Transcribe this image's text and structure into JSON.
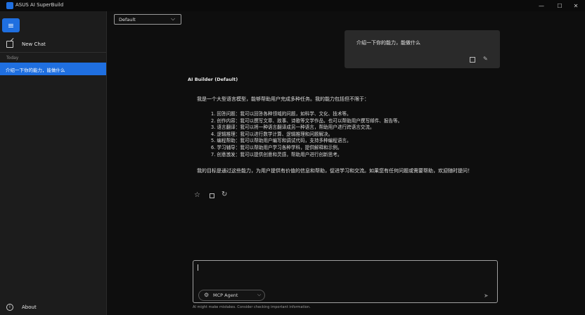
{
  "app": {
    "title": "ASUS AI SuperBuild",
    "window_controls": {
      "minimize": "—",
      "maximize": "☐",
      "close": "✕"
    }
  },
  "sidebar": {
    "menu_icon": "≡",
    "new_chat_label": "New Chat",
    "section_today": "Today",
    "history": [
      {
        "title": "介绍一下你的能力，能做什么",
        "selected": true
      }
    ],
    "about_label": "About",
    "about_icon": "i"
  },
  "toolbar": {
    "model_select_value": "Default",
    "model_select_chevron": "⌵"
  },
  "conversation": {
    "user_message": "介绍一下你的能力，能做什么",
    "edit_icon": "✎",
    "assistant_name": "AI Builder (Default)",
    "assistant_intro": "我是一个大型语言模型，能够帮助用户完成多种任务。我的能力包括但不限于：",
    "capabilities": [
      "1. 回答问题：我可以回答各种领域的问题，如科学、文化、技术等。",
      "2. 创作内容：我可以撰写文章、故事、诗歌等文学作品，也可以帮助用户撰写邮件、报告等。",
      "3. 语言翻译：我可以将一种语言翻译成另一种语言，帮助用户进行跨语言交流。",
      "4. 逻辑推理：我可以进行数学计算、逻辑推理和问题解决。",
      "5. 编程帮助：我可以帮助用户编写和调试代码，支持多种编程语言。",
      "6. 学习辅导：我可以帮助用户学习各种学科，提供解释和示例。",
      "7. 创意激发：我可以提供创意和灵感，帮助用户进行创新思考。"
    ],
    "assistant_closing": "我的目标是通过这些能力，为用户提供有价值的信息和帮助，促进学习和交流。如果您有任何问题或需要帮助，欢迎随时提问！",
    "actions": {
      "star_icon": "☆",
      "refresh_icon": "↻"
    }
  },
  "composer": {
    "input_value": "",
    "input_placeholder": "",
    "agent_label": "MCP Agent",
    "agent_icon": "⚙",
    "agent_chevron": "⌵",
    "send_icon": "➤"
  },
  "footer": {
    "disclaimer": "AI might make mistakes. Consider checking important information."
  },
  "colors": {
    "accent": "#1f6fe0",
    "sidebar_bg": "#1c1c1c",
    "main_bg": "#0e0e0e",
    "bubble_bg": "#2a2a2a"
  }
}
